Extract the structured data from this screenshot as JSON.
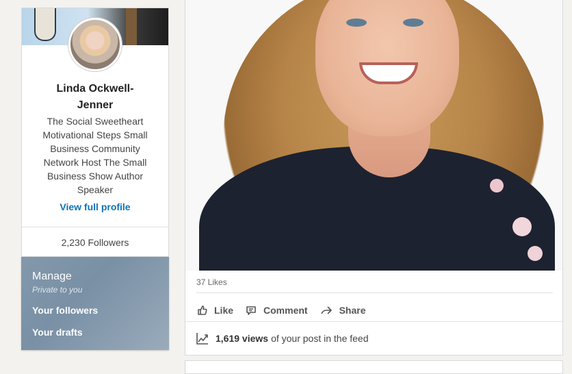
{
  "profile": {
    "name": "Linda Ockwell-Jenner",
    "headline": "The Social Sweetheart Motivational Steps Small Business Community Network Host The Small Business Show Author Speaker",
    "view_profile_label": "View full profile",
    "followers": "2,230 Followers"
  },
  "manage": {
    "title": "Manage",
    "subtitle": "Private to you",
    "links": [
      "Your followers",
      "Your drafts"
    ]
  },
  "post": {
    "likes": "37 Likes",
    "actions": [
      {
        "label": "Like",
        "icon": "thumbs-up-icon"
      },
      {
        "label": "Comment",
        "icon": "comment-icon"
      },
      {
        "label": "Share",
        "icon": "share-arrow-icon"
      }
    ],
    "views_count": "1,619 views",
    "views_text": "of your post in the feed",
    "views_icon": "analytics-chart-icon"
  },
  "colors": {
    "link": "#0a74b5",
    "manage_panel": "#8398ab"
  }
}
